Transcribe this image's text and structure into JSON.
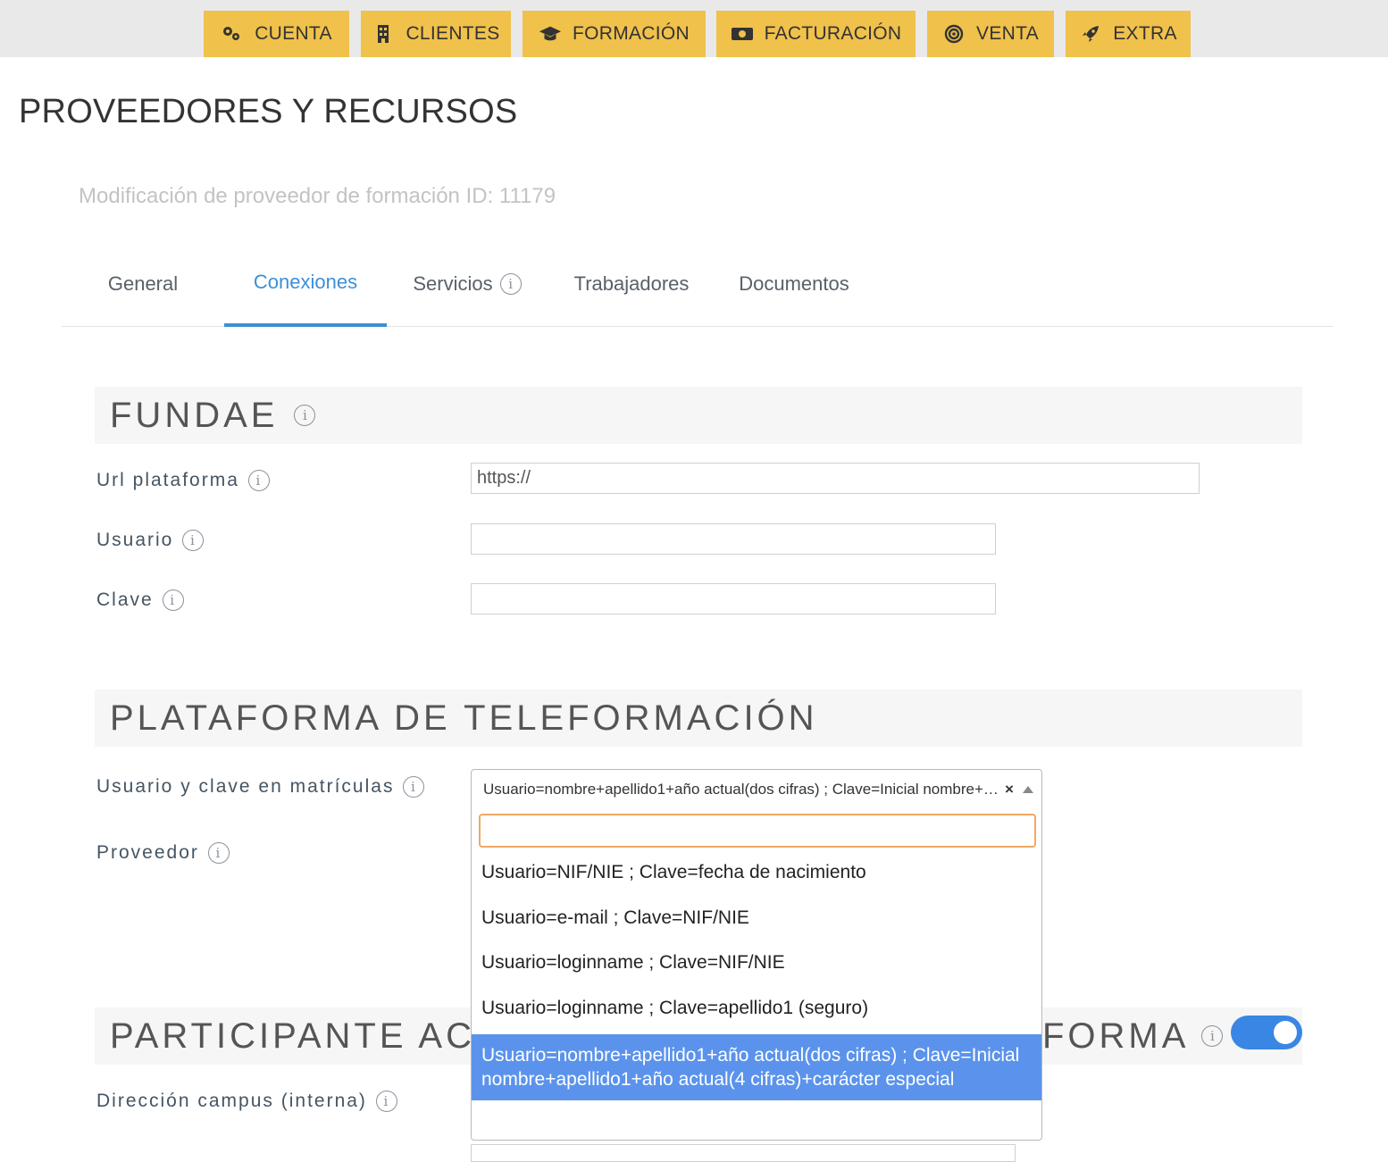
{
  "nav": [
    {
      "label": "CUENTA",
      "icon": "gears-icon"
    },
    {
      "label": "CLIENTES",
      "icon": "building-icon"
    },
    {
      "label": "FORMACIÓN",
      "icon": "graduation-cap-icon"
    },
    {
      "label": "FACTURACIÓN",
      "icon": "money-bill-icon"
    },
    {
      "label": "VENTA",
      "icon": "bullseye-icon"
    },
    {
      "label": "EXTRA",
      "icon": "rocket-icon"
    }
  ],
  "page_title": "PROVEEDORES Y RECURSOS",
  "subtitle": "Modificación de proveedor de formación ID: 11179",
  "tabs": [
    {
      "label": "General",
      "active": false
    },
    {
      "label": "Conexiones",
      "active": true
    },
    {
      "label": "Servicios",
      "active": false
    },
    {
      "label": "Trabajadores",
      "active": false
    },
    {
      "label": "Documentos",
      "active": false
    }
  ],
  "fundae": {
    "title": "FUNDAE",
    "url_label": "Url plataforma",
    "url_value": "https://",
    "usuario_label": "Usuario",
    "usuario_value": "",
    "clave_label": "Clave",
    "clave_value": ""
  },
  "teleformacion": {
    "title": "PLATAFORMA DE TELEFORMACIÓN",
    "usuario_clave_label": "Usuario y clave en matrículas",
    "selected_value": "Usuario=nombre+apellido1+año actual(dos cifras) ; Clave=Inicial nombre+apellido1+año actual(4 cifras)+carácter especial",
    "clear_symbol": "×",
    "proveedor_label": "Proveedor",
    "search_value": "",
    "options": [
      "Usuario=NIF/NIE ; Clave=fecha de nacimiento",
      "Usuario=e-mail ; Clave=NIF/NIE",
      "Usuario=loginname ; Clave=NIF/NIE",
      "Usuario=loginname ; Clave=apellido1 (seguro)",
      "Usuario=nombre+apellido1+año actual(dos cifras) ; Clave=Inicial nombre+apellido1+año actual(4 cifras)+carácter especial"
    ],
    "selected_index": 4
  },
  "participante": {
    "title_left": "PARTICIPANTE ACC",
    "title_right": "FORMA",
    "toggle_on": true,
    "direccion_label": "Dirección campus (interna)"
  },
  "colors": {
    "nav_bg": "#f0c14b",
    "accent": "#3d8fd6",
    "selected_option": "#5b93ec",
    "toggle": "#3a86e4"
  }
}
